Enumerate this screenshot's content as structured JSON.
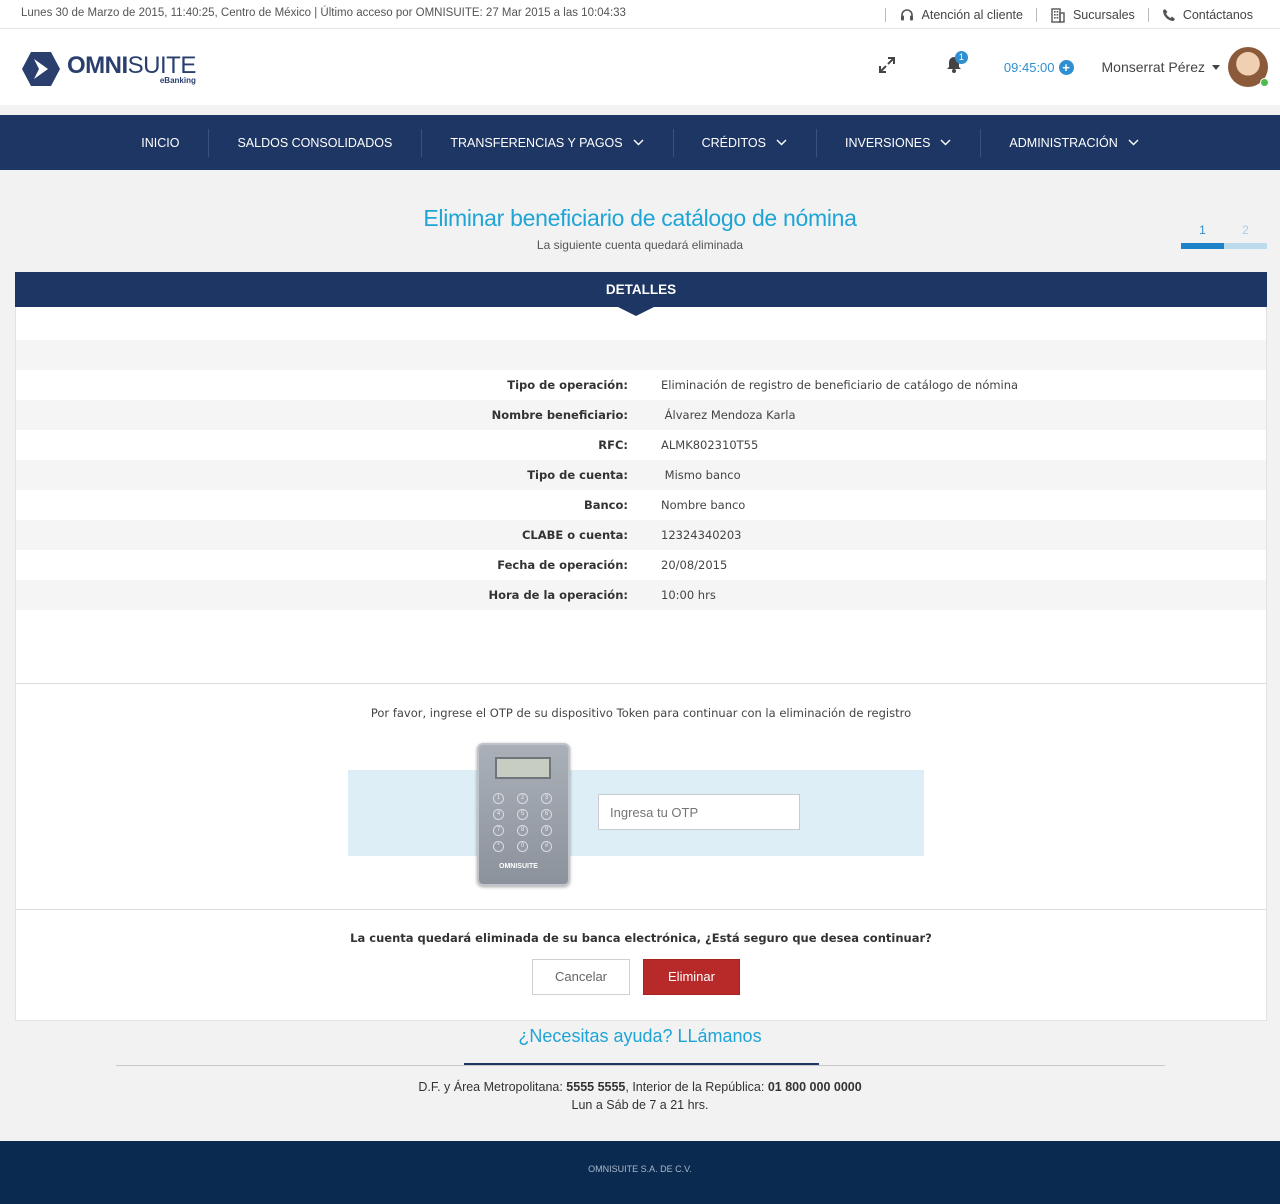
{
  "topbar": {
    "info": "Lunes 30 de Marzo de 2015, 11:40:25,  Centro de México | Último acceso por OMNISUITE: 27 Mar 2015 a las 10:04:33",
    "links": {
      "support": "Atención al cliente",
      "branches": "Sucursales",
      "contact": "Contáctanos"
    }
  },
  "header": {
    "logo": {
      "brand_bold": "OMNI",
      "brand_light": "SUITE",
      "sub": "eBanking"
    },
    "notifications_count": "1",
    "timer": "09:45:00",
    "timer_plus": "+",
    "user_name": "Monserrat Pérez"
  },
  "nav": {
    "items": [
      {
        "label": "INICIO"
      },
      {
        "label": "SALDOS CONSOLIDADOS"
      },
      {
        "label": "TRANSFERENCIAS Y PAGOS"
      },
      {
        "label": "CRÉDITOS"
      },
      {
        "label": "INVERSIONES"
      },
      {
        "label": "ADMINISTRACIÓN"
      }
    ]
  },
  "page": {
    "title": "Eliminar beneficiario de catálogo de nómina",
    "subtitle": "La siguiente cuenta quedará eliminada",
    "steps": {
      "step1": "1",
      "step2": "2",
      "current": 1
    }
  },
  "details": {
    "heading": "DETALLES",
    "rows": [
      {
        "label": "Tipo de operación:",
        "value": "Eliminación de registro de beneficiario de catálogo de nómina"
      },
      {
        "label": "Nombre beneficiario:",
        "value": " Álvarez Mendoza Karla"
      },
      {
        "label": "RFC:",
        "value": "ALMK802310T55"
      },
      {
        "label": "Tipo de cuenta:",
        "value": " Mismo banco"
      },
      {
        "label": "Banco:",
        "value": "Nombre banco"
      },
      {
        "label": "CLABE o cuenta:",
        "value": "12324340203"
      },
      {
        "label": "Fecha de operación:",
        "value": "20/08/2015"
      },
      {
        "label": "Hora de la operación:",
        "value": "10:00 hrs"
      }
    ]
  },
  "otp": {
    "message": "Por favor, ingrese el OTP de su dispositivo Token para continuar con la eliminación de registro",
    "placeholder": "Ingresa tu OTP",
    "token_keys": [
      "1",
      "2",
      "3",
      "4",
      "5",
      "6",
      "7",
      "8",
      "9",
      "*",
      "0",
      "#"
    ],
    "token_logo": "OMNISUITE"
  },
  "confirm": {
    "question": "La cuenta quedará eliminada de su banca electrónica, ¿Está seguro que desea continuar?",
    "cancel_label": "Cancelar",
    "delete_label": "Eliminar"
  },
  "help": {
    "title": "¿Necesitas ayuda? LLámanos",
    "df_label": "D.F. y Área Metropolitana: ",
    "df_phone": "5555 5555",
    "interior_label": ", Interior de la República: ",
    "interior_phone": "01 800 000 0000",
    "hours": "Lun a Sáb de 7 a 21 hrs."
  },
  "footer": {
    "text": "OMNISUITE S.A. DE C.V."
  },
  "colors": {
    "navy": "#1e3663",
    "accent_blue": "#1ea4d6",
    "danger": "#b82a2a",
    "footer": "#0b2a4f"
  }
}
